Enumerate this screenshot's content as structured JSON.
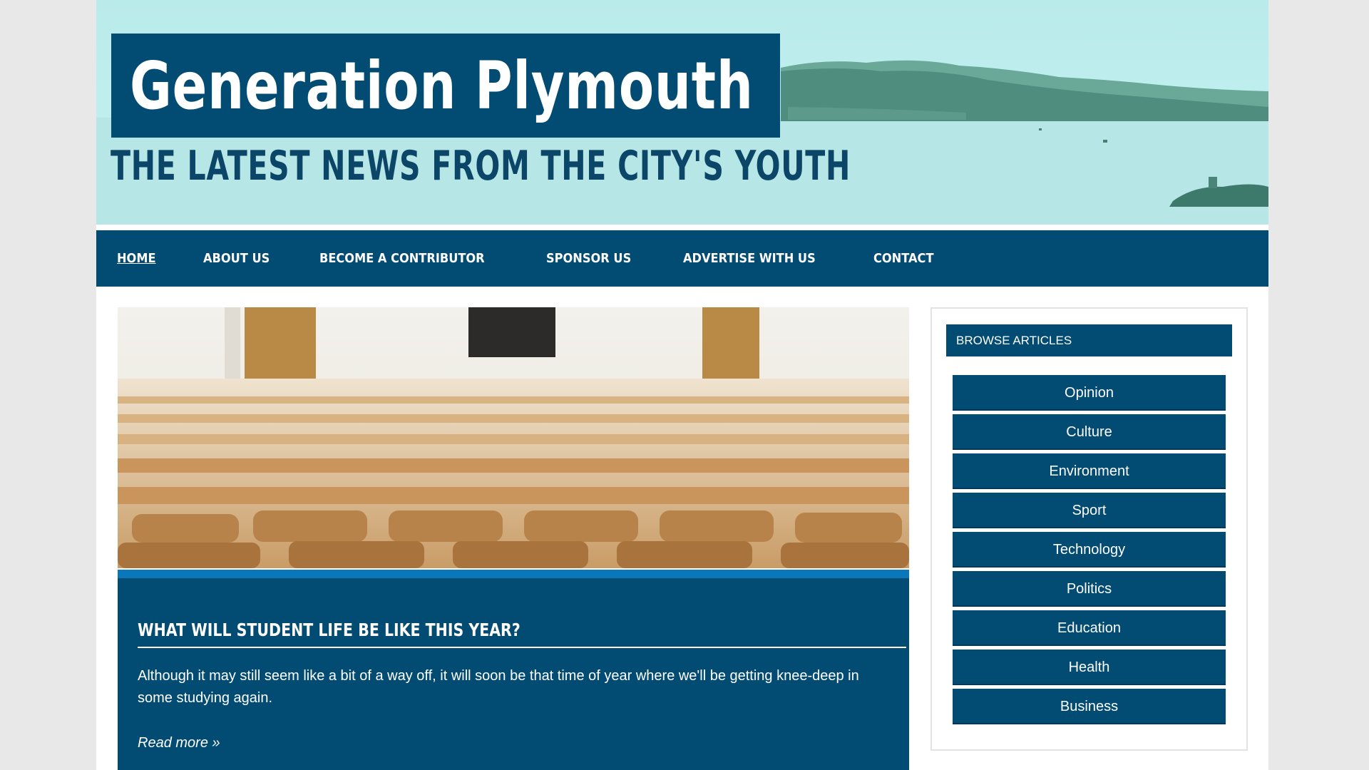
{
  "header": {
    "site_title": "Generation Plymouth",
    "tagline": "THE LATEST NEWS FROM THE CITY'S YOUTH"
  },
  "nav": {
    "items": [
      {
        "label": "HOME",
        "active": true
      },
      {
        "label": "ABOUT US",
        "active": false
      },
      {
        "label": "BECOME A CONTRIBUTOR",
        "active": false
      },
      {
        "label": "SPONSOR US",
        "active": false
      },
      {
        "label": "ADVERTISE WITH US",
        "active": false
      },
      {
        "label": "CONTACT",
        "active": false
      }
    ]
  },
  "featured": {
    "title": "WHAT WILL STUDENT LIFE BE LIKE THIS YEAR?",
    "excerpt": "Although it may still seem like a bit of a way off, it will soon be that time of year where we'll be getting knee-deep in some studying again.",
    "read_more": "Read more »"
  },
  "sidebar": {
    "heading": "BROWSE ARTICLES",
    "categories": [
      "Opinion",
      "Culture",
      "Environment",
      "Sport",
      "Technology",
      "Politics",
      "Education",
      "Health",
      "Business"
    ]
  },
  "colors": {
    "primary": "#024b72",
    "accent": "#0a77ba",
    "banner_bg": "#bfeeee"
  }
}
